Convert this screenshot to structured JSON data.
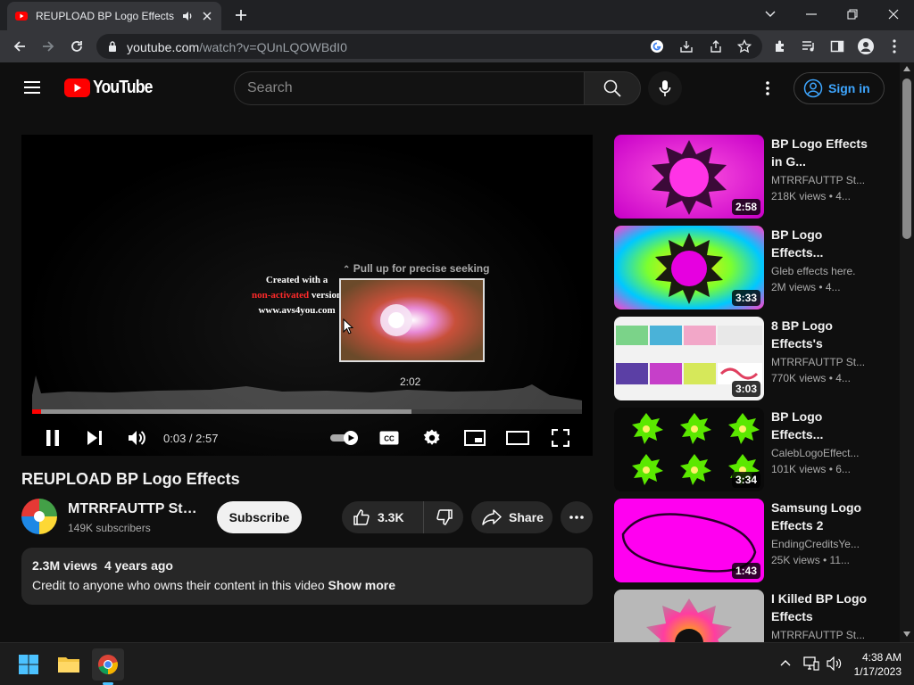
{
  "browser": {
    "tab_title": "REUPLOAD BP Logo Effects -",
    "url_host": "youtube.com",
    "url_path": "/watch?v=QUnLQOWBdI0"
  },
  "header": {
    "brand": "YouTube",
    "search_placeholder": "Search",
    "signin_label": "Sign in"
  },
  "player": {
    "watermark_line1": "Created with a",
    "watermark_red": "non-activated",
    "watermark_word": " version",
    "watermark_line3": "www.avs4you.com",
    "seek_hint": "Pull up for precise seeking",
    "preview_time": "2:02",
    "time_label": "0:03 / 2:57",
    "played_fraction": 0.017,
    "buffered_fraction": 0.69
  },
  "video": {
    "title": "REUPLOAD BP Logo Effects",
    "channel": "MTRRFAUTTP Studio",
    "subscribers": "149K subscribers",
    "subscribe_label": "Subscribe",
    "likes": "3.3K",
    "share_label": "Share",
    "views": "2.3M views",
    "age": "4 years ago",
    "description": "Credit to anyone who owns their content in this video",
    "show_more": "Show more"
  },
  "related": [
    {
      "title": "BP Logo Effects in G...",
      "channel": "MTRRFAUTTP St...",
      "meta": "218K views  • 4...",
      "duration": "2:58"
    },
    {
      "title": "BP Logo Effects...",
      "channel": "Gleb effects here.",
      "meta": "2M views  • 4...",
      "duration": "3:33"
    },
    {
      "title": "8 BP Logo Effects's",
      "channel": "MTRRFAUTTP St...",
      "meta": "770K views  • 4...",
      "duration": "3:03"
    },
    {
      "title": "BP Logo Effects...",
      "channel": "CalebLogoEffect...",
      "meta": "101K views  • 6...",
      "duration": "3:34"
    },
    {
      "title": "Samsung Logo Effects 2",
      "channel": "EndingCreditsYe...",
      "meta": "25K views  • 11...",
      "duration": "1:43"
    },
    {
      "title": "I Killed BP Logo Effects",
      "channel": "MTRRFAUTTP St...",
      "meta": "",
      "duration": ""
    }
  ],
  "taskbar": {
    "time": "4:38 AM",
    "date": "1/17/2023"
  },
  "colors": {
    "accent": "#ff0000",
    "link": "#3ea6ff"
  }
}
